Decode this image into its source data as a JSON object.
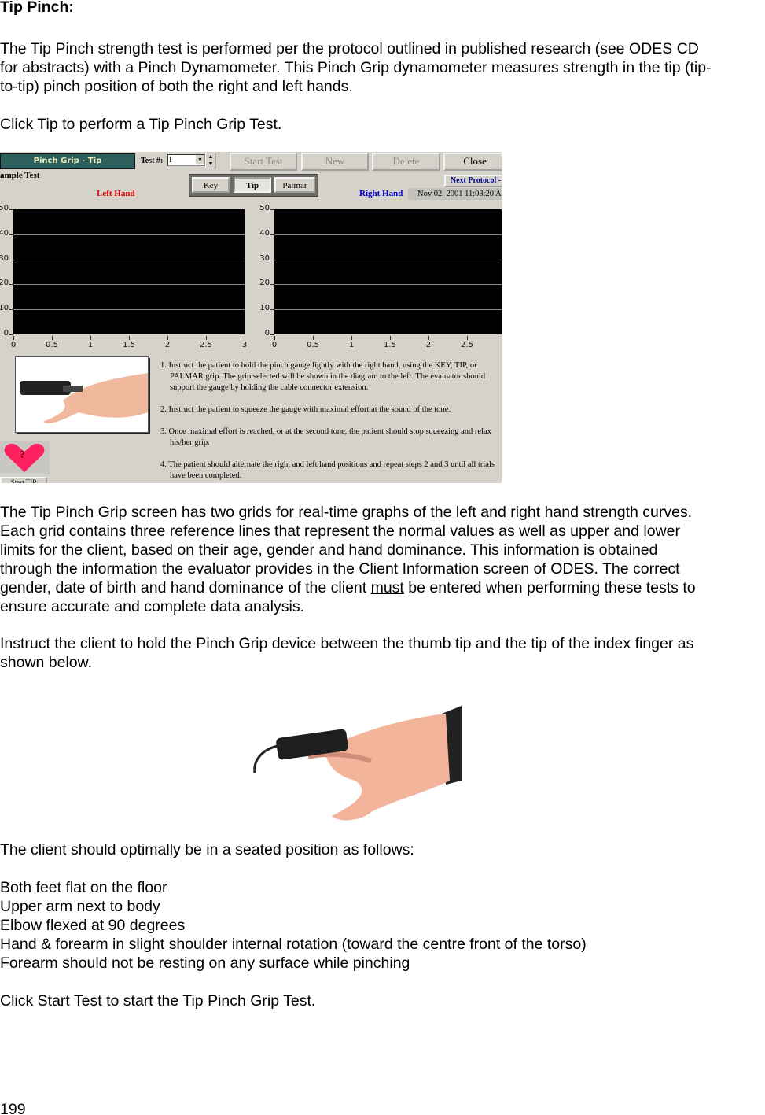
{
  "doc": {
    "title": "Tip Pinch:",
    "intro": [
      "The Tip Pinch strength test is performed per the protocol outlined in published research (see ODES CD",
      "for abstracts) with a Pinch Dynamometer.  This Pinch Grip dynamometer measures strength in the tip (tip-",
      "to-tip) pinch position of both the right and left hands."
    ],
    "click_tip": "Click Tip to perform a Tip Pinch Grip Test.",
    "grids": [
      "The Tip Pinch Grip screen has two grids for real-time graphs of the left and right hand strength curves.",
      "Each grid contains three reference lines that represent the normal values as well as upper and lower",
      "limits for the client, based on their age, gender and hand dominance.  This information is obtained",
      "through the information the evaluator provides in the Client Information screen of ODES.  The correct"
    ],
    "grids_l5_a": "gender, date of birth and hand dominance of the client ",
    "grids_l5_u": "must",
    "grids_l5_b": " be entered when performing these tests to",
    "grids_l6": "ensure accurate and complete data analysis.",
    "instruct": [
      "Instruct the client to hold the Pinch Grip device between the thumb tip and the tip of the index finger as",
      "shown below."
    ],
    "seated": "The client should optimally be in a seated position as follows:",
    "positions": [
      "Both feet flat on the floor",
      "Upper arm next to body",
      "Elbow flexed at 90 degrees",
      "Hand & forearm in slight shoulder internal rotation (toward the centre front of the torso)",
      "Forearm should not be resting on any surface while pinching"
    ],
    "start": "Click Start Test to start the Tip Pinch Grip Test.",
    "page_number": "199"
  },
  "app": {
    "header": "Pinch Grip - Tip",
    "test_label": "Test #:",
    "test_value": "1",
    "buttons": {
      "start": "Start Test",
      "new": "New",
      "delete": "Delete",
      "close": "Close",
      "next": "Next Protocol -"
    },
    "sample": "ample Test",
    "grip_tabs": [
      "Key",
      "Tip",
      "Palmar"
    ],
    "left_hand": "Left Hand",
    "right_hand": "Right Hand",
    "datetime": "Nov 02, 2001 11:03:20 A",
    "start_tip": "Start TIP",
    "instructions": [
      "1.  Instruct the patient to hold the pinch gauge lightly with the right hand, using the KEY, TIP, or PALMAR grip.  The grip selected will be shown in the diagram to the left.  The evaluator should support the gauge by holding the cable connector extension.",
      "2.  Instruct the patient to squeeze the gauge with maximal effort at the sound of the tone.",
      "3.  Once maximal effort is reached, or at the second tone, the patient should stop squeezing and relax his/her grip.",
      "4.  The patient should alternate the right and left hand positions and repeat steps 2 and 3 until  all trials have been completed."
    ],
    "charts": [
      {
        "name": "left",
        "y_ticks": [
          "50",
          "40",
          "30",
          "20",
          "10",
          "0"
        ],
        "x_ticks": [
          "0",
          "0.5",
          "1",
          "1.5",
          "2",
          "2.5",
          "3"
        ],
        "ylim": [
          0,
          50
        ],
        "xlim": [
          0,
          3
        ]
      },
      {
        "name": "right",
        "y_ticks": [
          "50",
          "40",
          "30",
          "20",
          "10",
          "0"
        ],
        "x_ticks": [
          "0",
          "0.5",
          "1",
          "1.5",
          "2",
          "2.5"
        ],
        "ylim": [
          0,
          50
        ],
        "xlim": [
          0,
          3
        ]
      }
    ],
    "colors": {
      "header_bg": "#2f5f5c",
      "left_hand": "#e00000",
      "right_hand": "#0000cc",
      "panel": "#d5d2c9"
    }
  }
}
